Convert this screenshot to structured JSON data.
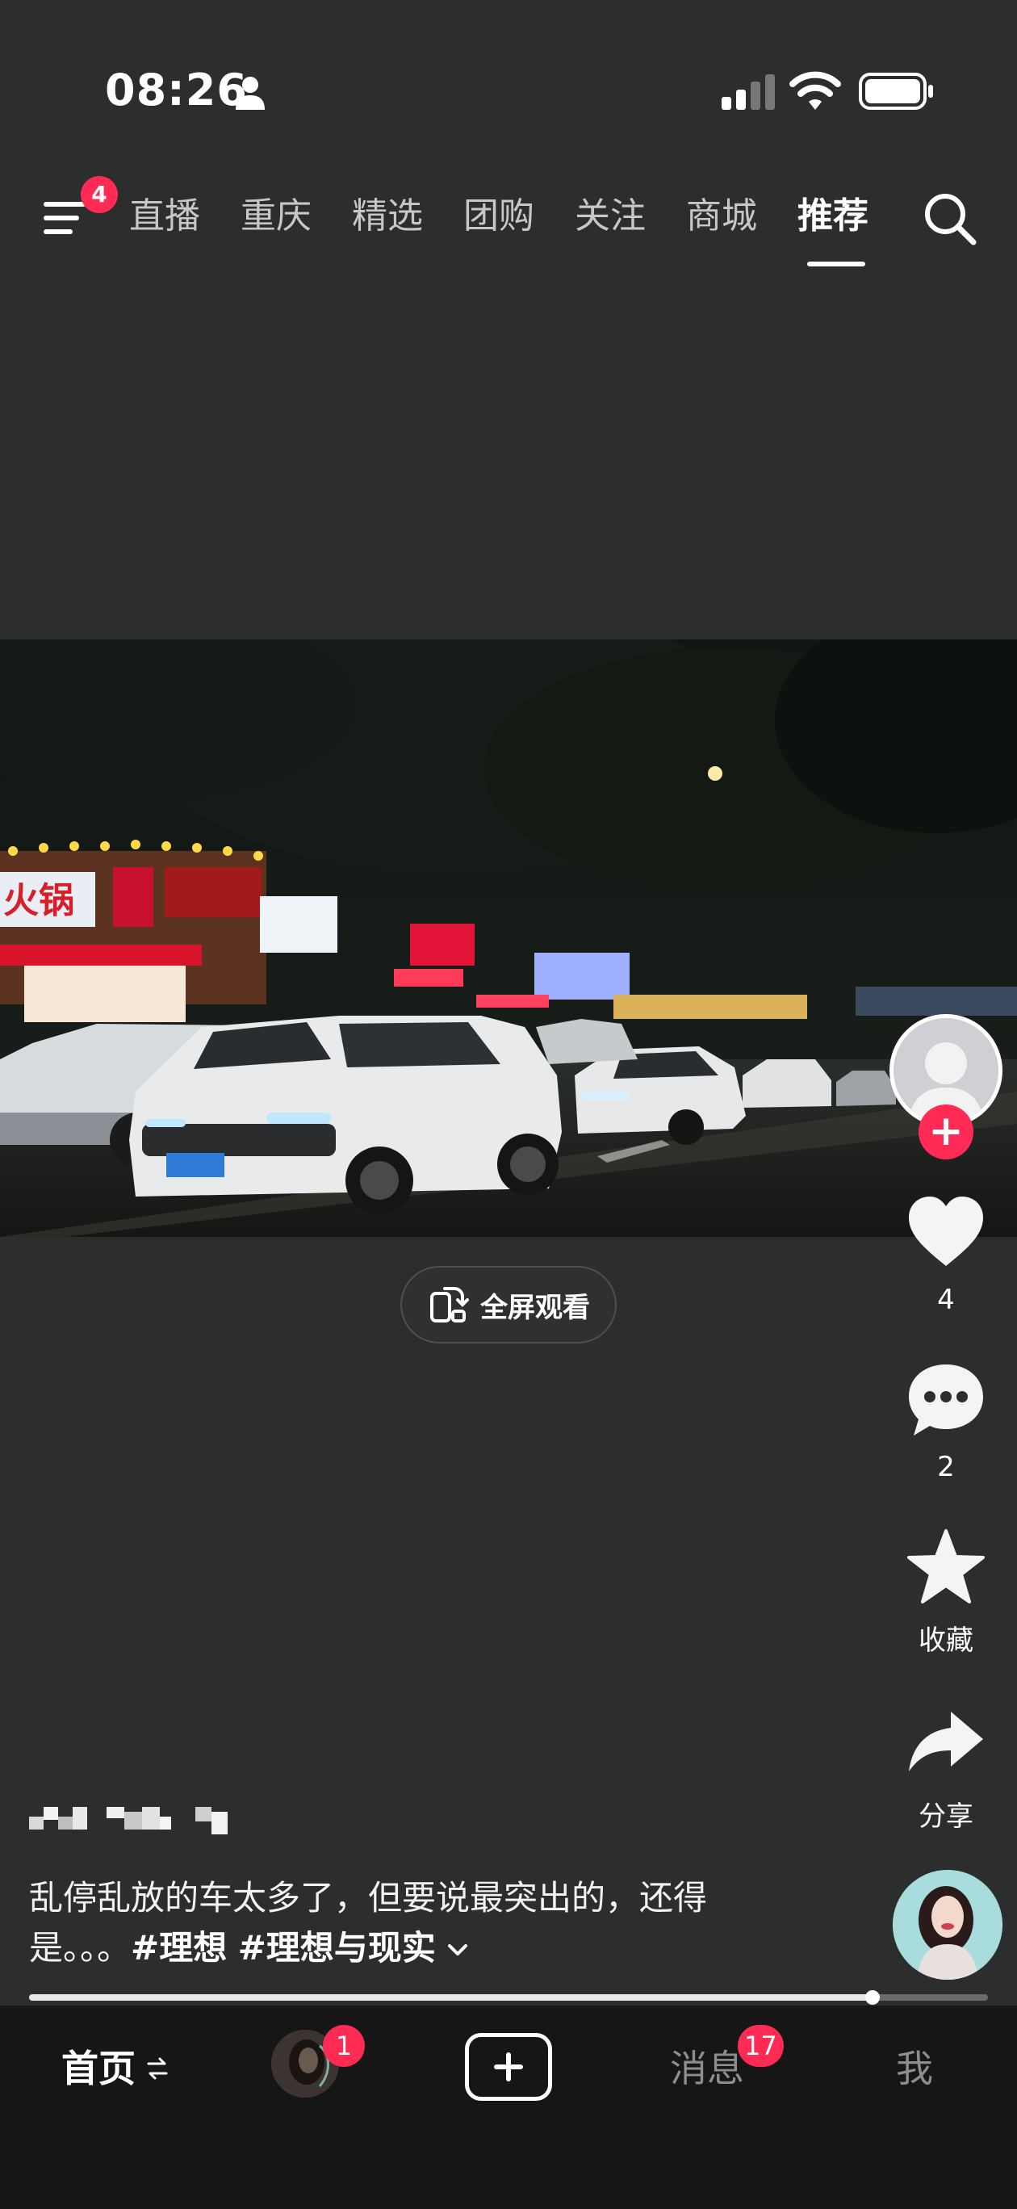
{
  "status_bar": {
    "time": "08:26",
    "icons": [
      "person-icon",
      "signal-icon",
      "wifi-icon",
      "battery-icon"
    ]
  },
  "top_nav": {
    "menu_badge": "4",
    "tabs": [
      "直播",
      "重庆",
      "精选",
      "团购",
      "关注",
      "商城",
      "推荐"
    ],
    "active_tab": "推荐"
  },
  "video": {
    "fullscreen_label": "全屏观看",
    "storefront_signs": [
      "火锅"
    ]
  },
  "right_rail": {
    "like_count": "4",
    "comment_count": "2",
    "favorite_label": "收藏",
    "share_label": "分享"
  },
  "caption": {
    "text": "乱停乱放的车太多了，但要说最突出的，还得是。。。",
    "hashtags": [
      "#理想",
      "#理想与现实"
    ]
  },
  "playback": {
    "progress": 0.88
  },
  "bottom_nav": {
    "home": "首页",
    "friend_badge": "1",
    "messages": "消息",
    "messages_badge": "17",
    "me": "我"
  },
  "colors": {
    "accent": "#ff2b55",
    "background": "#2b2e2c",
    "bottom_bar": "#161616"
  }
}
